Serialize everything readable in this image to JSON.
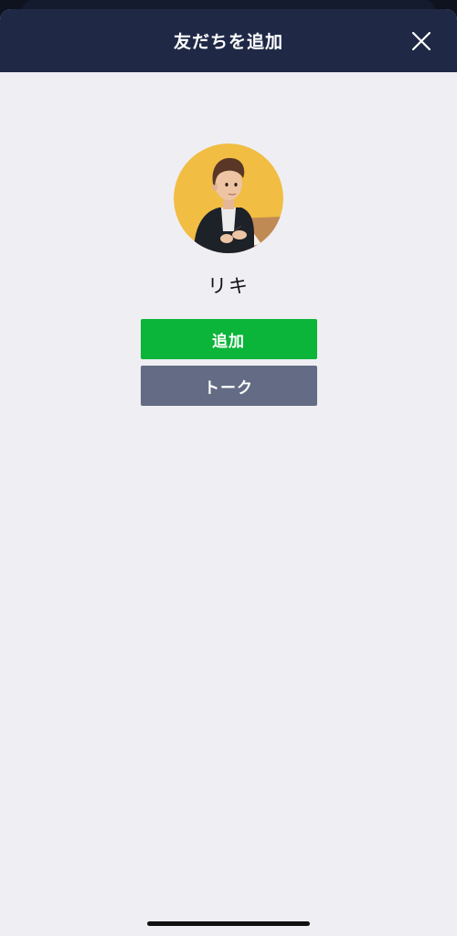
{
  "header": {
    "title": "友だちを追加",
    "close_icon": "close-icon"
  },
  "profile": {
    "name": "リキ",
    "avatar_icon": "user-avatar"
  },
  "actions": {
    "add_label": "追加",
    "talk_label": "トーク"
  },
  "colors": {
    "header_bg": "#1f2946",
    "background": "#efeef3",
    "add_button": "#0bb53a",
    "talk_button": "#636c84",
    "avatar_bg": "#f1bd43"
  }
}
